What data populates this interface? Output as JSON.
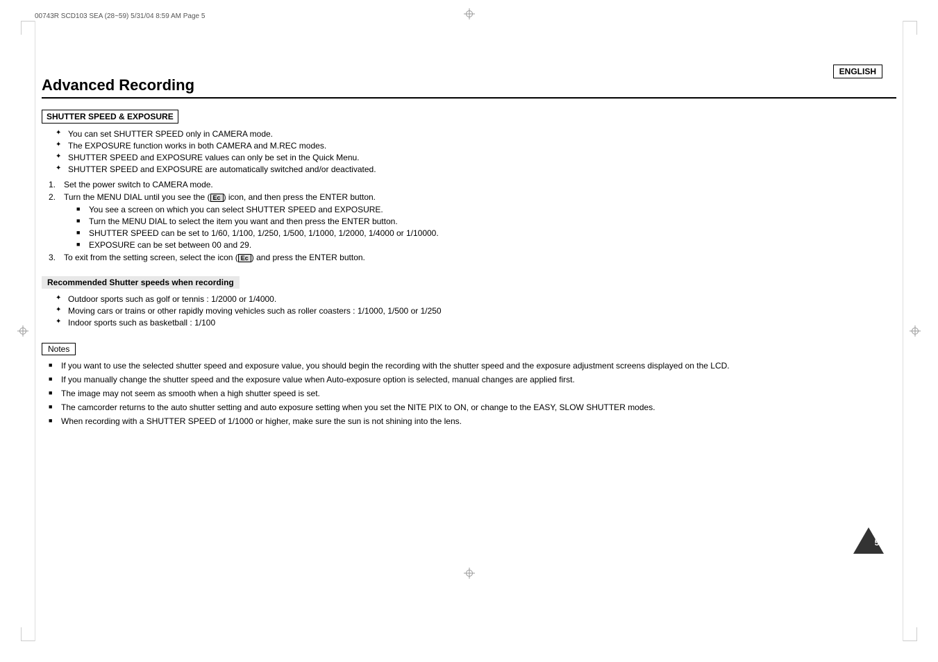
{
  "header": {
    "code": "00743R SCD103 SEA (28~59)   5/31/04 8:59 AM   Page 5",
    "language_label": "ENGLISH"
  },
  "page_title": "Advanced Recording",
  "section1": {
    "heading": "SHUTTER SPEED & EXPOSURE",
    "cross_bullets": [
      "You can set SHUTTER SPEED only in CAMERA mode.",
      "The EXPOSURE function works in both CAMERA and M.REC modes.",
      "SHUTTER SPEED and EXPOSURE values can only be set in the Quick Menu.",
      "SHUTTER SPEED and EXPOSURE are automatically switched and/or deactivated."
    ],
    "numbered_steps": [
      {
        "num": "1.",
        "text": "Set the power switch to CAMERA mode."
      },
      {
        "num": "2.",
        "text": "Turn the MENU DIAL until you see the (",
        "icon": "Ec",
        "text_after": ") icon, and then press the ENTER button.",
        "sub_bullets": [
          "You see a screen on which you can select SHUTTER SPEED and EXPOSURE.",
          "Turn the MENU DIAL to select the item you want and then press the ENTER button.",
          "SHUTTER SPEED can be set to 1/60, 1/100, 1/250, 1/500, 1/1000, 1/2000, 1/4000 or 1/10000.",
          "EXPOSURE can be set between 00 and 29."
        ]
      },
      {
        "num": "3.",
        "text": "To exit from the setting screen, select the icon (",
        "icon": "Ec",
        "text_after": ") and press the ENTER button."
      }
    ]
  },
  "section2": {
    "heading": "Recommended Shutter speeds when recording",
    "cross_bullets": [
      "Outdoor sports such as golf or tennis : 1/2000 or 1/4000.",
      "Moving cars or trains or other rapidly moving vehicles such as roller coasters : 1/1000, 1/500 or 1/250",
      "Indoor sports such as basketball : 1/100"
    ]
  },
  "notes": {
    "label": "Notes",
    "items": [
      "If you want to use the selected shutter speed and exposure value, you should begin the recording with the shutter speed and the exposure adjustment screens displayed on the LCD.",
      "If you manually change the shutter speed and the exposure value when Auto-exposure option is selected, manual changes are applied first.",
      "The image may not seem as smooth when a high shutter speed is set.",
      "The camcorder returns to the auto shutter setting and auto exposure setting when you set the NITE PIX to ON, or change to the EASY, SLOW SHUTTER modes.",
      "When recording with a SHUTTER SPEED of 1/1000 or higher, make sure the sun is not shining into the lens."
    ]
  },
  "page_number": "57"
}
